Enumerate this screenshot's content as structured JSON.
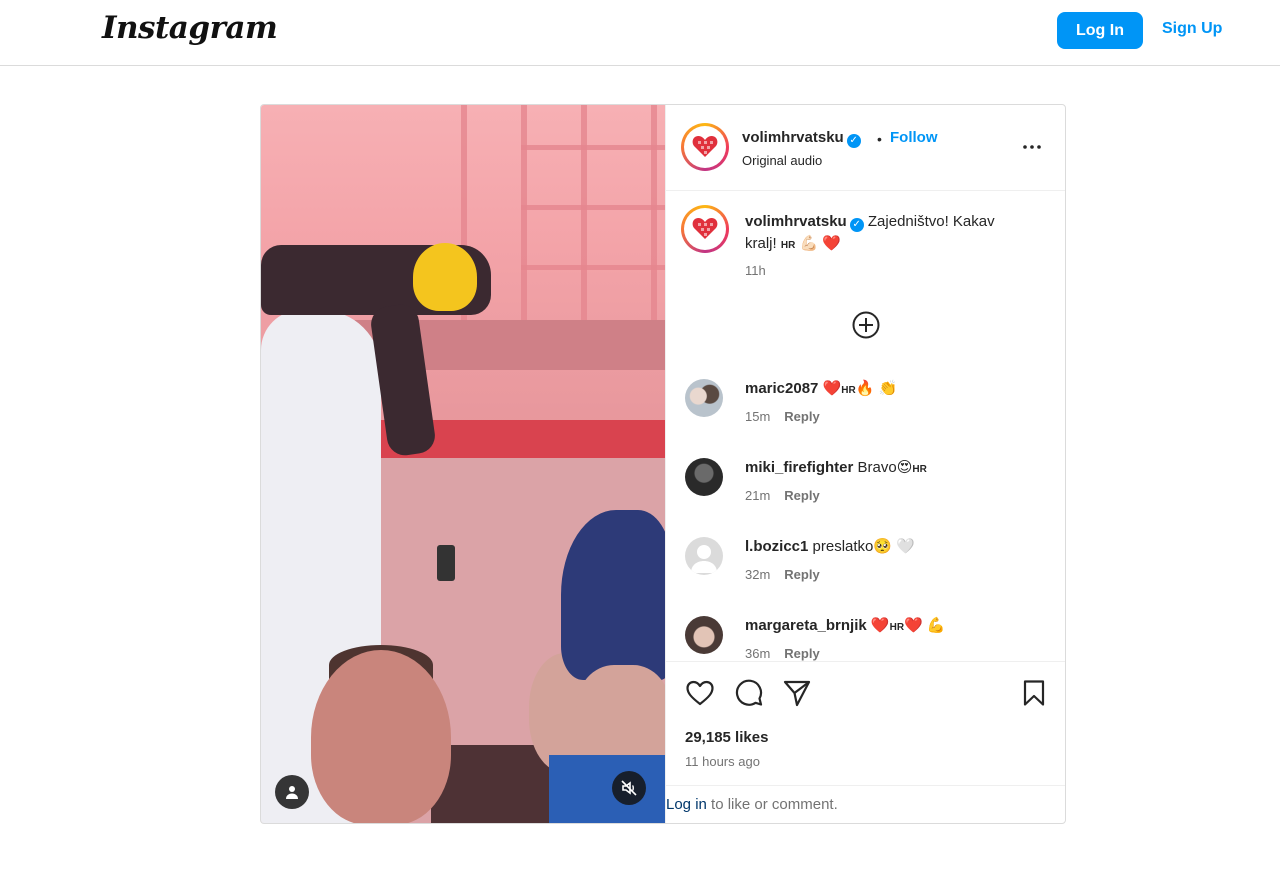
{
  "nav": {
    "logo": "Instagram",
    "login_label": "Log In",
    "signup_label": "Sign Up"
  },
  "post": {
    "username": "volimhrvatsku",
    "separator": "•",
    "follow_label": "Follow",
    "audio": "Original audio",
    "caption": {
      "username": "volimhrvatsku",
      "text_line1": "Zajedništvo! Kakav",
      "text_line2": "kralj!",
      "flag": "HR",
      "emoji": "💪🏻 ❤️",
      "time": "11h"
    },
    "media_icons": [
      "user-tag-icon",
      "muted-icon"
    ],
    "likes": "29,185 likes",
    "time_ago": "11 hours ago"
  },
  "comments": [
    {
      "username": "maric2087",
      "pre_emoji": "❤️",
      "flag": "HR",
      "post_emoji": "🔥 👏",
      "text": "",
      "time": "15m",
      "reply": "Reply"
    },
    {
      "username": "miki_firefighter",
      "pre_emoji": "",
      "flag": "HR",
      "post_emoji": "",
      "text": "Bravo😍",
      "time": "21m",
      "reply": "Reply"
    },
    {
      "username": "l.bozicc1",
      "pre_emoji": "",
      "flag": "",
      "post_emoji": "",
      "text": "preslatko🥺 🤍",
      "time": "32m",
      "reply": "Reply"
    },
    {
      "username": "margareta_brnjik",
      "pre_emoji": "❤️",
      "flag": "HR",
      "post_emoji": "❤️ 💪",
      "text": "",
      "time": "36m",
      "reply": "Reply"
    }
  ],
  "footer": {
    "login_link": "Log in",
    "rest": "to like or comment."
  },
  "colors": {
    "accent": "#0095f6",
    "link_dark": "#00376b",
    "muted": "#737373",
    "heart_red": "#ed4956"
  }
}
